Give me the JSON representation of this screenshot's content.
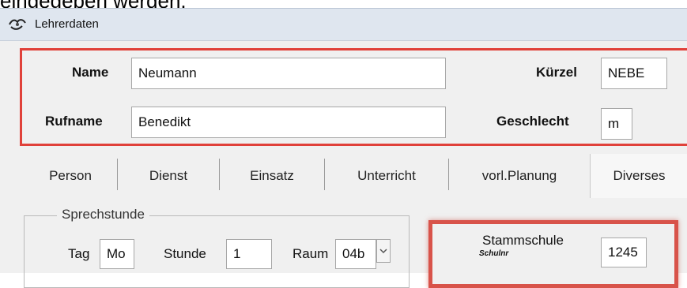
{
  "caption": "eingegeben werden.",
  "window": {
    "title": "Lehrerdaten",
    "icon": "app-hands-icon"
  },
  "person_fields": {
    "name_label": "Name",
    "name_value": "Neumann",
    "kuerzel_label": "Kürzel",
    "kuerzel_value": "NEBE",
    "rufname_label": "Rufname",
    "rufname_value": "Benedikt",
    "geschlecht_label": "Geschlecht",
    "geschlecht_value": "m"
  },
  "tabs": [
    {
      "label": "Person"
    },
    {
      "label": "Dienst"
    },
    {
      "label": "Einsatz"
    },
    {
      "label": "Unterricht"
    },
    {
      "label": "vorl.Planung"
    },
    {
      "label": "Diverses",
      "active": true
    }
  ],
  "sprechstunde": {
    "title": "Sprechstunde",
    "tag_label": "Tag",
    "tag_value": "Mo",
    "stunde_label": "Stunde",
    "stunde_value": "1",
    "raum_label": "Raum",
    "raum_value": "04b"
  },
  "stammschule": {
    "label": "Stammschule",
    "sublabel": "Schulnr",
    "value": "1245"
  },
  "colors": {
    "highlight": "#e0413a",
    "titlebar": "#dfe6ef",
    "panel": "#f0f0f0"
  }
}
